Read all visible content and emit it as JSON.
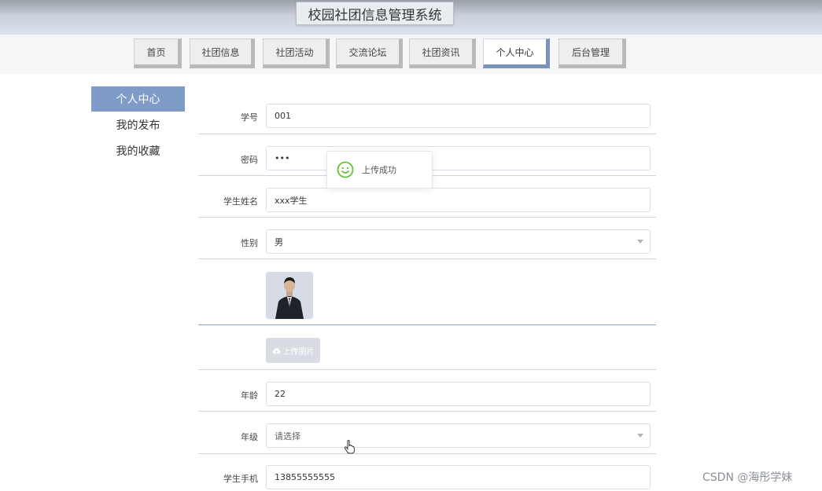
{
  "app": {
    "title": "校园社团信息管理系统"
  },
  "nav": {
    "items": [
      {
        "label": "首页"
      },
      {
        "label": "社团信息"
      },
      {
        "label": "社团活动"
      },
      {
        "label": "交流论坛"
      },
      {
        "label": "社团资讯"
      },
      {
        "label": "个人中心",
        "active": true
      },
      {
        "label": "后台管理"
      }
    ]
  },
  "sidebar": {
    "items": [
      {
        "label": "个人中心",
        "active": true
      },
      {
        "label": "我的发布"
      },
      {
        "label": "我的收藏"
      }
    ]
  },
  "form": {
    "student_id": {
      "label": "学号",
      "value": "001"
    },
    "password": {
      "label": "密码",
      "value": "•••"
    },
    "name": {
      "label": "学生姓名",
      "value": "xxx学生"
    },
    "gender": {
      "label": "性别",
      "value": "男"
    },
    "upload_label": "上传图片",
    "age": {
      "label": "年龄",
      "value": "22"
    },
    "grade": {
      "label": "年级",
      "placeholder": "请选择"
    },
    "phone": {
      "label": "学生手机",
      "value": "13855555555"
    }
  },
  "toast": {
    "message": "上传成功",
    "icon": "smile-icon",
    "color": "#67c23a"
  },
  "watermark": "CSDN @海彤学妹",
  "colors": {
    "accent": "#7f9bc7",
    "nav_active_shadow": "#7b93b9"
  }
}
